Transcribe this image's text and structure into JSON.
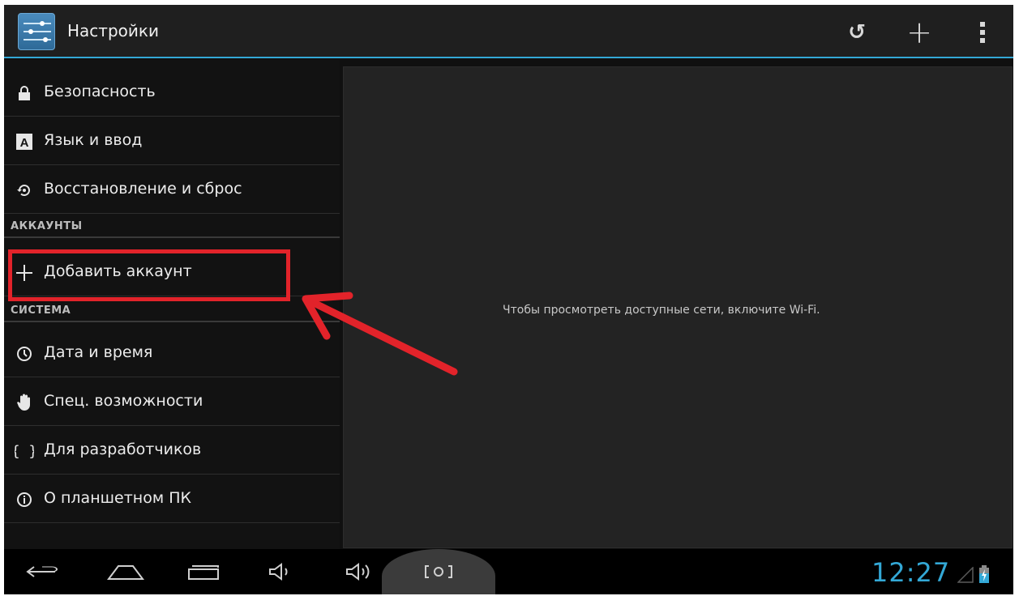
{
  "app": {
    "title": "Настройки",
    "icon": "settings-sliders-icon"
  },
  "actions": [
    {
      "name": "sync-icon",
      "glyph": "↺"
    },
    {
      "name": "add-icon",
      "glyph": "+"
    },
    {
      "name": "overflow-menu-icon",
      "glyph": "⋮"
    }
  ],
  "menu": {
    "security": "Безопасность",
    "language": "Язык и ввод",
    "backup": "Восстановление и сброс",
    "accounts_header": "АККАУНТЫ",
    "add_account": "Добавить аккаунт",
    "system_header": "СИСТЕМА",
    "datetime": "Дата и время",
    "accessibility": "Спец. возможности",
    "developer": "Для разработчиков",
    "about": "О планшетном ПК"
  },
  "icons": {
    "security": "lock-icon",
    "language": "keyboard-a-icon",
    "backup": "restore-icon",
    "add_account": "plus-icon",
    "datetime": "clock-icon",
    "accessibility": "hand-icon",
    "developer": "braces-icon",
    "about": "info-icon"
  },
  "detail": {
    "message": "Чтобы просмотреть доступные сети, включите Wi-Fi."
  },
  "annotation": {
    "color": "#e2232a"
  },
  "navbar": {
    "buttons": [
      "back-icon",
      "home-icon",
      "recents-icon",
      "volume-down-icon",
      "volume-up-icon",
      "screenshot-icon"
    ],
    "clock": "12:27"
  },
  "colors": {
    "accent": "#33a8d6",
    "background": "#101010",
    "pane": "#232323"
  }
}
